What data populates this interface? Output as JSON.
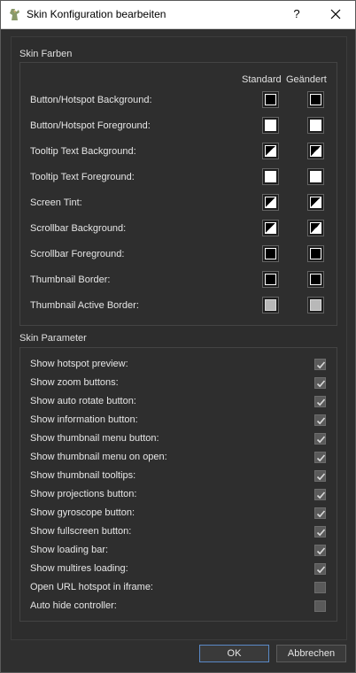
{
  "window": {
    "title": "Skin Konfiguration bearbeiten",
    "help_label": "?",
    "icons": {
      "app": "skin-app-icon",
      "close": "close-icon"
    }
  },
  "skin_colors": {
    "title": "Skin Farben",
    "col_standard": "Standard",
    "col_changed": "Geändert",
    "rows": [
      {
        "label": "Button/Hotspot Background:",
        "standard": "black",
        "changed": "black"
      },
      {
        "label": "Button/Hotspot Foreground:",
        "standard": "white",
        "changed": "white"
      },
      {
        "label": "Tooltip Text Background:",
        "standard": "black-white-diagonal",
        "changed": "black-white-diagonal"
      },
      {
        "label": "Tooltip Text Foreground:",
        "standard": "white",
        "changed": "white"
      },
      {
        "label": "Screen Tint:",
        "standard": "black-white-diagonal",
        "changed": "black-white-diagonal"
      },
      {
        "label": "Scrollbar Background:",
        "standard": "black-white-diagonal",
        "changed": "black-white-diagonal"
      },
      {
        "label": "Scrollbar Foreground:",
        "standard": "black",
        "changed": "black"
      },
      {
        "label": "Thumbnail Border:",
        "standard": "black",
        "changed": "black"
      },
      {
        "label": "Thumbnail Active Border:",
        "standard": "gray",
        "changed": "gray"
      }
    ]
  },
  "skin_params": {
    "title": "Skin Parameter",
    "rows": [
      {
        "label": "Show hotspot preview:",
        "checked": true
      },
      {
        "label": "Show zoom buttons:",
        "checked": true
      },
      {
        "label": "Show auto rotate button:",
        "checked": true
      },
      {
        "label": "Show information button:",
        "checked": true
      },
      {
        "label": "Show thumbnail menu button:",
        "checked": true
      },
      {
        "label": "Show thumbnail menu on open:",
        "checked": true
      },
      {
        "label": "Show thumbnail tooltips:",
        "checked": true
      },
      {
        "label": "Show projections button:",
        "checked": true
      },
      {
        "label": "Show gyroscope button:",
        "checked": true
      },
      {
        "label": "Show fullscreen button:",
        "checked": true
      },
      {
        "label": "Show loading bar:",
        "checked": true
      },
      {
        "label": "Show multires loading:",
        "checked": true
      },
      {
        "label": "Open URL hotspot in iframe:",
        "checked": false
      },
      {
        "label": "Auto hide controller:",
        "checked": false
      }
    ]
  },
  "buttons": {
    "ok": "OK",
    "cancel": "Abbrechen"
  }
}
